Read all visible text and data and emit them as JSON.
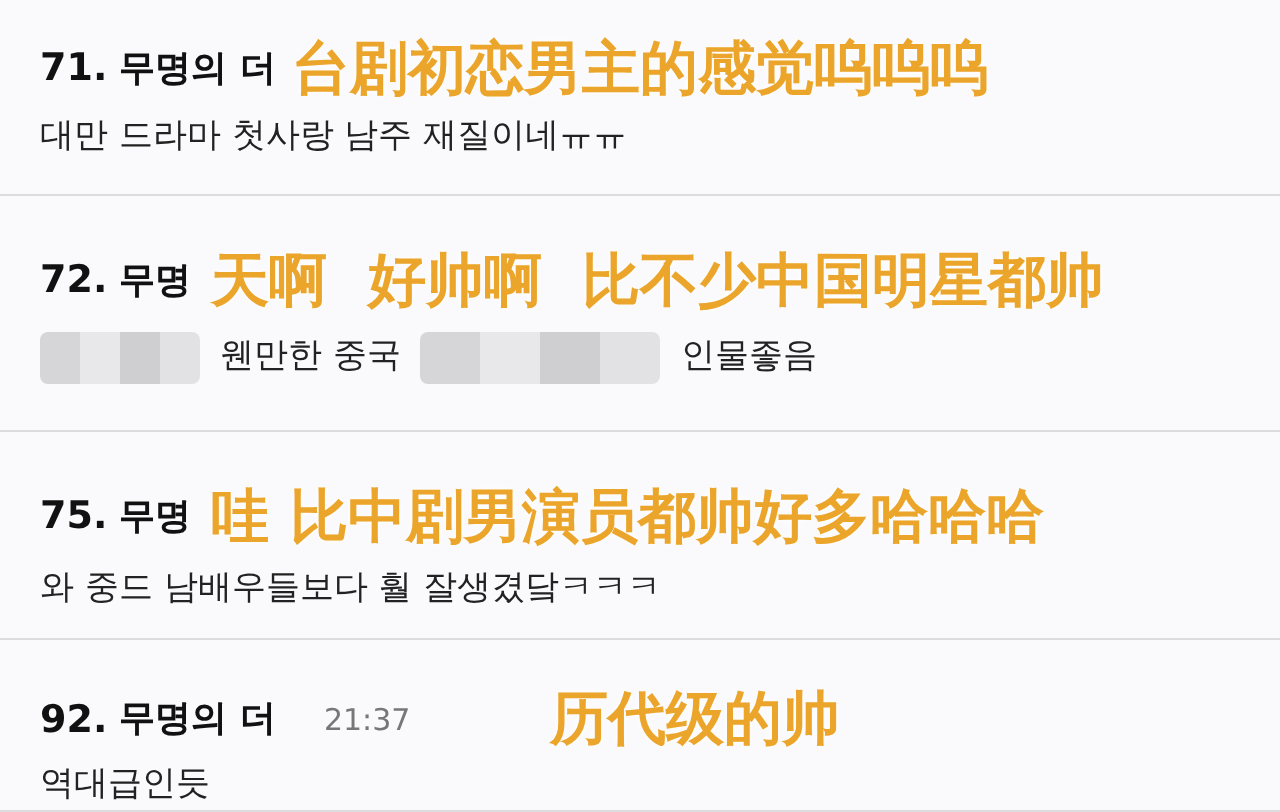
{
  "comments": [
    {
      "number": "71.",
      "author": "무명의 더",
      "caption": "台剧初恋男主的感觉呜呜呜",
      "body": [
        "대만 드라마 첫사랑 남주 재질이네ㅠㅠ"
      ]
    },
    {
      "number": "72.",
      "author": "무명",
      "caption": "天啊  好帅啊  比不少中国明星都帅",
      "body": [
        "웬만한 중국",
        "인물좋음"
      ],
      "censored": true
    },
    {
      "number": "75.",
      "author": "무명",
      "caption": "哇 比中剧男演员都帅好多哈哈哈",
      "body": [
        "와 중드 남배우들보다 훨 잘생겼닼ㅋㅋㅋ"
      ]
    },
    {
      "number": "92.",
      "author": "무명의 더",
      "time": "21:37",
      "caption": "历代级的帅",
      "body": [
        "역대급인듯"
      ]
    }
  ]
}
